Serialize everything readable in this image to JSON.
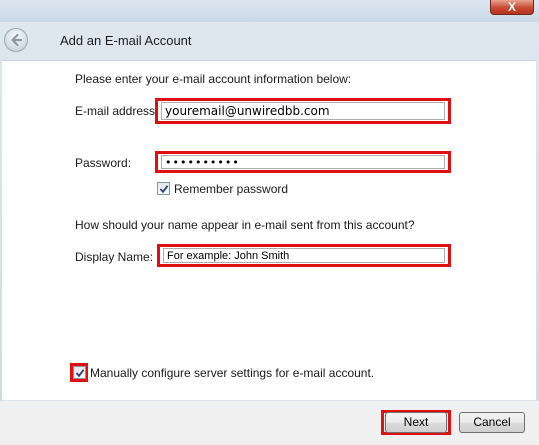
{
  "window": {
    "title": "Add an E-mail Account",
    "close_label": "X"
  },
  "form": {
    "intro": "Please enter your e-mail account information below:",
    "email_label": "E-mail address:",
    "email_value": "youremail@unwiredbb.com",
    "password_label": "Password:",
    "password_value": "••••••••••",
    "remember_label": "Remember password",
    "remember_checked": true,
    "name_question": "How should your name appear in e-mail sent from this account?",
    "display_name_label": "Display Name:",
    "display_name_placeholder": "For example: John Smith",
    "manual_config_label": "Manually configure server settings for e-mail account.",
    "manual_config_checked": true
  },
  "footer": {
    "next_label": "Next",
    "cancel_label": "Cancel"
  },
  "colors": {
    "highlight": "#e01010"
  },
  "icons": {
    "back": "back-arrow-icon",
    "close": "close-icon",
    "check": "checkmark-icon"
  }
}
